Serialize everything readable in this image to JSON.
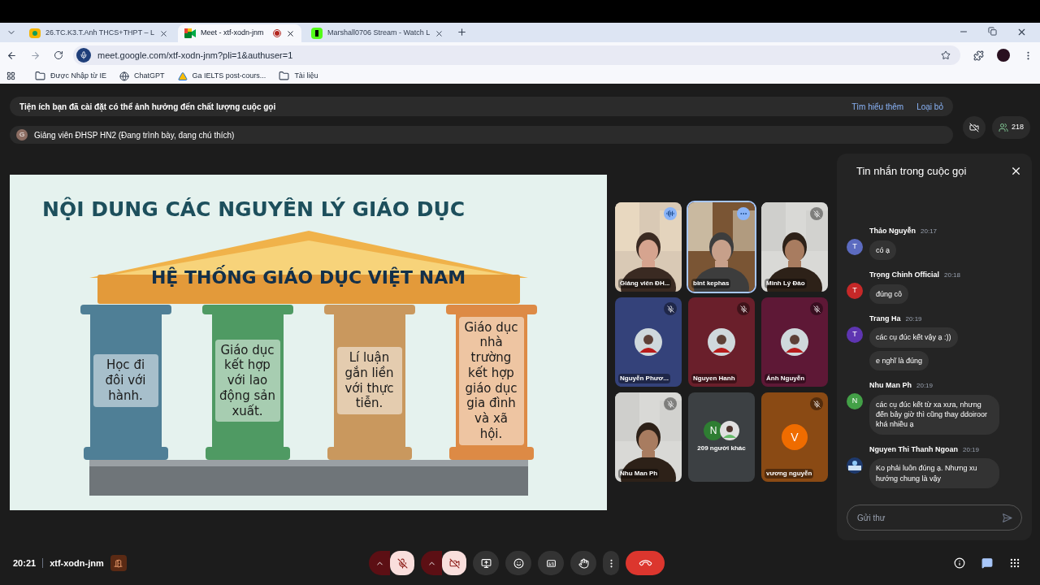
{
  "browser": {
    "tabs": [
      {
        "title": "26.TC.K3.T.Anh THCS+THPT – L",
        "kind": "classroom",
        "selected": false,
        "recording": false
      },
      {
        "title": "Meet - xtf-xodn-jnm",
        "kind": "meet",
        "selected": true,
        "recording": true
      },
      {
        "title": "Marshall0706 Stream - Watch L",
        "kind": "kick",
        "selected": false,
        "recording": false
      }
    ],
    "url": "meet.google.com/xtf-xodn-jnm?pli=1&authuser=1",
    "bookmarks": [
      {
        "label": "Được Nhập từ IE",
        "kind": "folder"
      },
      {
        "label": "ChatGPT",
        "kind": "site"
      },
      {
        "label": "Ga IELTS post-cours...",
        "kind": "drive"
      },
      {
        "label": "Tài liệu",
        "kind": "folder"
      }
    ]
  },
  "banners": [
    {
      "kind": "notice",
      "text": "Tiện ích bạn đã cài đặt có thể ảnh hưởng đến chất lượng cuộc gọi",
      "links": [
        "Tìm hiểu thêm",
        "Loại bỏ"
      ]
    },
    {
      "kind": "presenter",
      "avatar": "G",
      "text": "Giảng viên ĐHSP HN2 (Đang trình bày, đang chú thích)"
    }
  ],
  "participant_count": "218",
  "slide": {
    "title": "NỘI DUNG CÁC NGUYÊN LÝ GIÁO DỤC",
    "roof": "HỆ THỐNG GIÁO DỤC VIỆT NAM",
    "pillars": [
      {
        "text": "Học đi đôi với hành.",
        "color": "#4f7f96"
      },
      {
        "text": "Giáo dục kết hợp với lao động sản xuất.",
        "color": "#4f9a63"
      },
      {
        "text": "Lí luận gắn liền với thực tiễn.",
        "color": "#c9985e"
      },
      {
        "text": "Giáo dục nhà trường kết hợp giáo dục gia đình và xã hội.",
        "color": "#dd8a45"
      }
    ]
  },
  "tiles": [
    {
      "name": "Giảng viên ĐH...",
      "kind": "video",
      "muted": false,
      "speaking": true,
      "focused": false
    },
    {
      "name": "bint kephas",
      "kind": "video",
      "muted": false,
      "speaking": false,
      "focused": true
    },
    {
      "name": "Minh Lý Đào",
      "kind": "video",
      "muted": true,
      "speaking": false,
      "focused": false
    },
    {
      "name": "Nguyễn Phươ...",
      "color": "#34427a",
      "muted": true,
      "speaking": false,
      "focused": false
    },
    {
      "name": "Nguyen Hanh",
      "color": "#6a1f2b",
      "muted": true,
      "speaking": false,
      "focused": false
    },
    {
      "name": "Ánh Nguyễn",
      "color": "#5e1836",
      "muted": true,
      "speaking": false,
      "focused": false
    },
    {
      "name": "Nhu Man Ph",
      "kind": "video",
      "muted": true,
      "speaking": false,
      "focused": false
    },
    {
      "name": "209 người khác",
      "kind": "others",
      "letter": "N",
      "muted": false,
      "speaking": false,
      "focused": false
    },
    {
      "name": "vương nguyễn",
      "kind": "letter",
      "letter": "V",
      "color": "#8a4a14",
      "muted": true,
      "speaking": false,
      "focused": false
    }
  ],
  "chat": {
    "title": "Tin nhắn trong cuộc gọi",
    "placeholder": "Gửi thư",
    "groups": [
      {
        "name": "Thảo Nguyễn",
        "time": "20:17",
        "kind": "letter",
        "letter": "T",
        "color": "#5c6bc0",
        "messages": [
          "có ạ"
        ]
      },
      {
        "name": "Trọng Chinh Official",
        "time": "20:18",
        "kind": "letter",
        "letter": "T",
        "color": "#c62828",
        "messages": [
          "đúng cô"
        ]
      },
      {
        "name": "Trang Ha",
        "time": "20:19",
        "kind": "letter",
        "letter": "T",
        "color": "#5e35b1",
        "messages": [
          "các cụ đúc kết vậy ạ :))",
          "e nghĩ là đúng"
        ]
      },
      {
        "name": "Nhu Man Ph",
        "time": "20:19",
        "kind": "letter",
        "letter": "N",
        "color": "#43a047",
        "messages": [
          "các cụ đúc kết từ xa xưa, nhưng đến bây giờ thì cũng thay ddoiroor khá nhiều ạ"
        ]
      },
      {
        "name": "Nguyen Thi Thanh Ngoan",
        "time": "20:19",
        "kind": "picture",
        "messages": [
          "Ko phải luôn đúng ạ. Nhưng xu hướng chung là vậy"
        ]
      }
    ]
  },
  "bottom": {
    "time": "20:21",
    "code": "xtf-xodn-jnm",
    "mic_on": false,
    "camera_on": false
  }
}
